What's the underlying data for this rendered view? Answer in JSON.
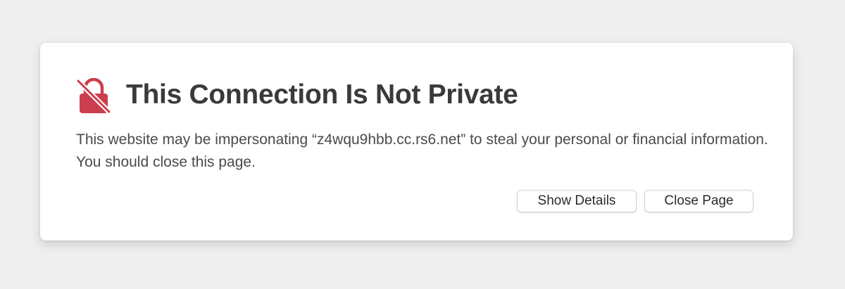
{
  "colors": {
    "background": "#efefef",
    "card": "#ffffff",
    "lock_icon": "#cc3e4d",
    "title_text": "#3a3a3a",
    "body_text": "#4a4a4a"
  },
  "warning": {
    "icon": "lock-slash-icon",
    "title": "This Connection Is Not Private",
    "message": "This website may be impersonating “z4wqu9hbb.cc.rs6.net” to steal your personal or financial information. You should close this page."
  },
  "actions": {
    "show_details_label": "Show Details",
    "close_page_label": "Close Page"
  }
}
